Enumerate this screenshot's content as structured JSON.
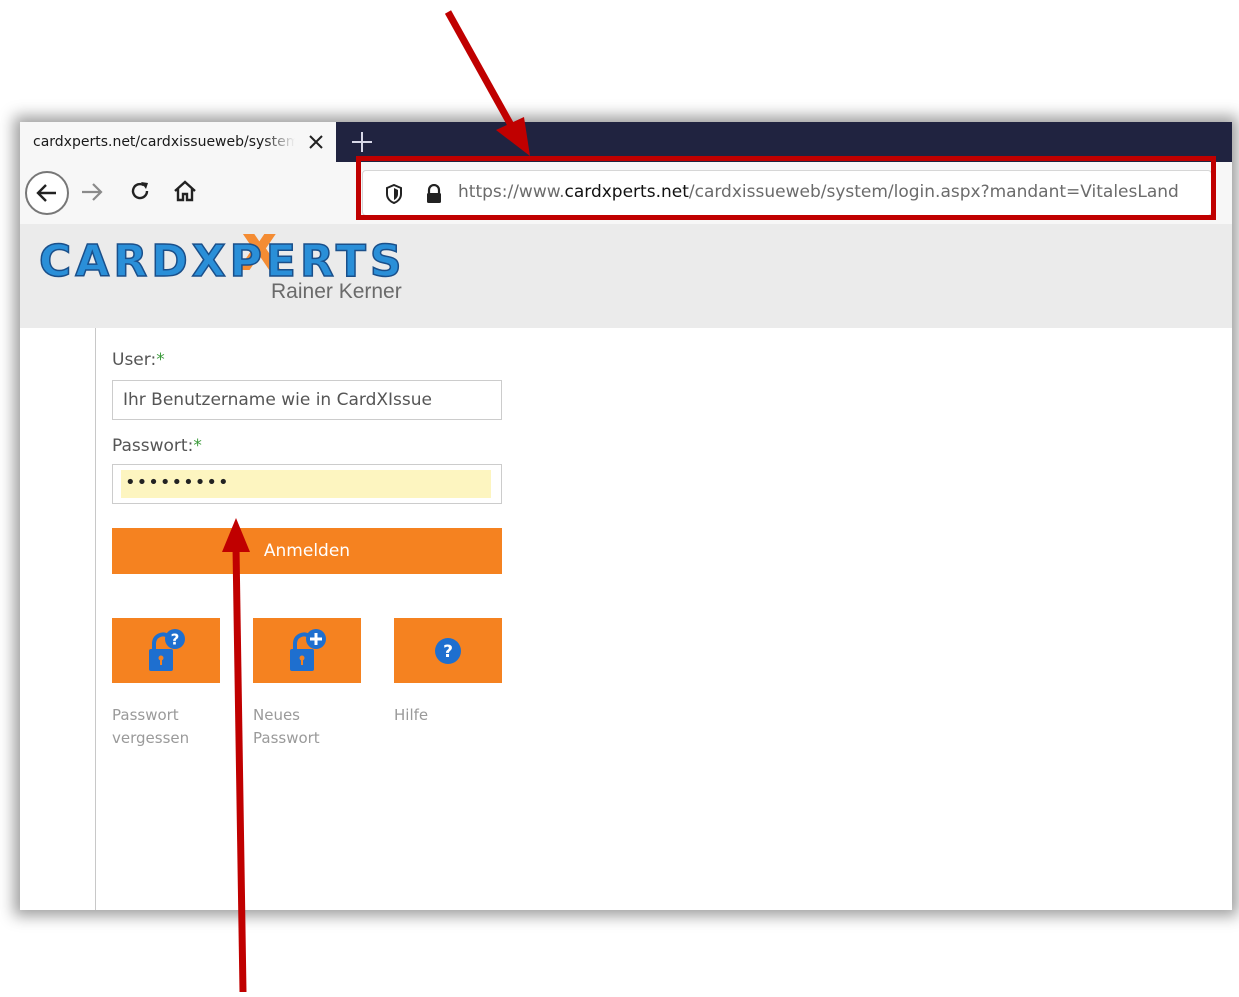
{
  "browser": {
    "tab_title": "cardxperts.net/cardxissueweb/system",
    "url_scheme": "https://www.",
    "url_host": "cardxperts.net",
    "url_path": "/cardxissueweb/system/login.aspx?mandant=VitalesLand"
  },
  "header": {
    "logo_text": "CARDXPERTS",
    "logo_subtitle": "Rainer Kerner"
  },
  "form": {
    "user_label": "User:",
    "user_required": "*",
    "user_placeholder": "Ihr Benutzername wie in CardXIssue",
    "password_label": "Passwort:",
    "password_required": "*",
    "password_masked": "•••••••••",
    "login_button": "Anmelden"
  },
  "tiles": [
    {
      "label": "Passwort vergessen",
      "icon": "lock-question-icon"
    },
    {
      "label": "Neues Passwort",
      "icon": "lock-plus-icon"
    },
    {
      "label": "Hilfe",
      "icon": "help-icon"
    }
  ],
  "colors": {
    "accent_orange": "#f58220",
    "icon_blue": "#1e6fcf",
    "annotation_red": "#c00000",
    "tabbar_dark": "#202340"
  }
}
